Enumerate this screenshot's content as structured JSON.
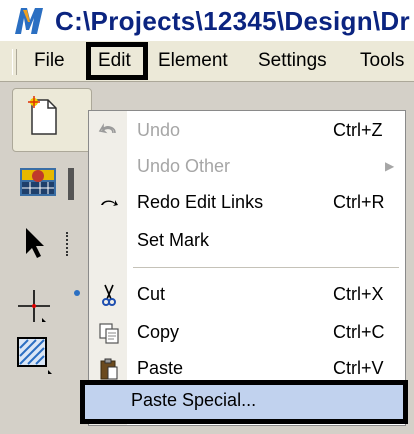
{
  "title_bar": {
    "title": "C:\\Projects\\12345\\Design\\Dr"
  },
  "menubar": {
    "items": [
      {
        "label": "File"
      },
      {
        "label": "Edit"
      },
      {
        "label": "Element"
      },
      {
        "label": "Settings"
      },
      {
        "label": "Tools"
      }
    ]
  },
  "edit_menu": {
    "items": [
      {
        "label": "Undo",
        "shortcut": "Ctrl+Z",
        "enabled": false,
        "icon": "undo-icon"
      },
      {
        "label": "Undo Other",
        "shortcut": "",
        "enabled": false,
        "submenu": true
      },
      {
        "label": "Redo Edit Links",
        "shortcut": "Ctrl+R",
        "enabled": true,
        "icon": "redo-icon"
      },
      {
        "label": "Set Mark",
        "shortcut": "",
        "enabled": true
      },
      {
        "label": "Cut",
        "shortcut": "Ctrl+X",
        "enabled": true,
        "icon": "scissors-icon"
      },
      {
        "label": "Copy",
        "shortcut": "Ctrl+C",
        "enabled": true,
        "icon": "copy-icon"
      },
      {
        "label": "Paste",
        "shortcut": "Ctrl+V",
        "enabled": true,
        "icon": "clipboard-icon"
      },
      {
        "label": "Paste Special...",
        "shortcut": "",
        "enabled": true,
        "highlighted": true
      }
    ]
  },
  "colors": {
    "title_text": "#0b2480",
    "disabled_text": "#a6a6a6",
    "highlight": "#c1d2ee"
  }
}
